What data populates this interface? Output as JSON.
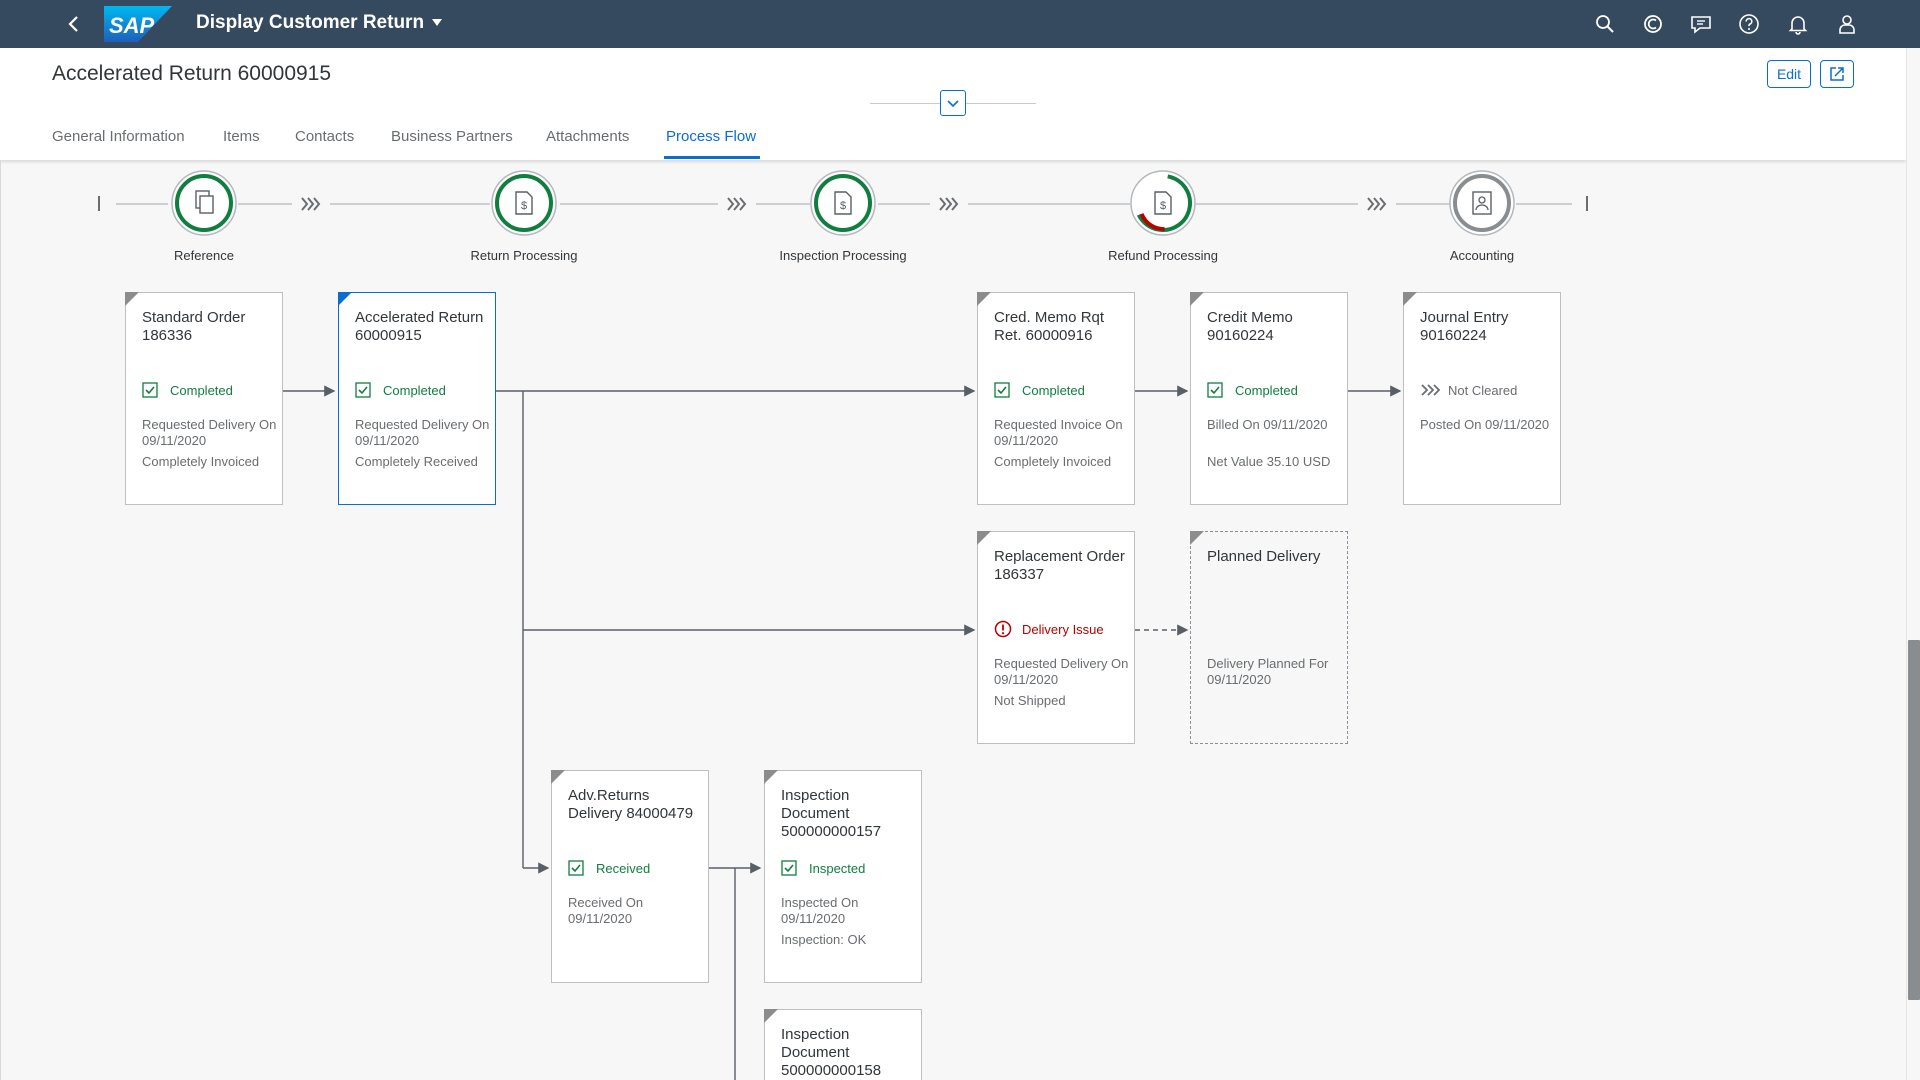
{
  "app": {
    "title": "Display Customer Return"
  },
  "header": {
    "title": "Accelerated Return 60000915",
    "edit_label": "Edit"
  },
  "tabs": [
    {
      "label": "General Information",
      "active": false
    },
    {
      "label": "Items",
      "active": false
    },
    {
      "label": "Contacts",
      "active": false
    },
    {
      "label": "Business Partners",
      "active": false
    },
    {
      "label": "Attachments",
      "active": false
    },
    {
      "label": "Process Flow",
      "active": true
    }
  ],
  "lanes": [
    {
      "label": "Reference",
      "icon": "documents-icon",
      "state": "completed"
    },
    {
      "label": "Return Processing",
      "icon": "sales-document-icon",
      "state": "completed"
    },
    {
      "label": "Inspection Processing",
      "icon": "sales-document-icon",
      "state": "completed"
    },
    {
      "label": "Refund Processing",
      "icon": "sales-document-icon",
      "state": "partial-issue"
    },
    {
      "label": "Accounting",
      "icon": "journal-icon",
      "state": "neutral"
    }
  ],
  "nodes": {
    "standard_order": {
      "title": "Standard Order 186336",
      "status": "Completed",
      "attr1": "Requested Delivery On 09/11/2020",
      "attr2": "Completely Invoiced"
    },
    "accelerated_return": {
      "title": "Accelerated Return 60000915",
      "status": "Completed",
      "attr1": "Requested Delivery On 09/11/2020",
      "attr2": "Completely Received"
    },
    "cred_memo_rqt": {
      "title": "Cred. Memo Rqt Ret. 60000916",
      "status": "Completed",
      "attr1": "Requested Invoice On 09/11/2020",
      "attr2": "Completely Invoiced"
    },
    "credit_memo": {
      "title": "Credit Memo 90160224",
      "status": "Completed",
      "attr1": "Billed On 09/11/2020",
      "attr2": "Net Value 35.10 USD"
    },
    "journal_entry": {
      "title": "Journal Entry 90160224",
      "status": "Not Cleared",
      "attr1": "Posted On 09/11/2020",
      "attr2": ""
    },
    "replacement_order": {
      "title": "Replacement Order 186337",
      "status": "Delivery Issue",
      "attr1": "Requested Delivery On 09/11/2020",
      "attr2": "Not Shipped"
    },
    "planned_delivery": {
      "title": "Planned Delivery",
      "status": "",
      "attr1": "Delivery Planned For 09/11/2020",
      "attr2": ""
    },
    "adv_returns_delivery": {
      "title": "Adv.Returns Delivery 84000479",
      "status": "Received",
      "attr1": "Received On 09/11/2020",
      "attr2": ""
    },
    "inspection_157": {
      "title": "Inspection Document 500000000157",
      "status": "Inspected",
      "attr1": "Inspected On 09/11/2020",
      "attr2": "Inspection: OK"
    },
    "inspection_158": {
      "title": "Inspection Document 500000000158",
      "status": "",
      "attr1": "",
      "attr2": ""
    }
  },
  "colors": {
    "shell": "#354a5f",
    "accent": "#0a6ed1",
    "positive": "#107e3e",
    "negative": "#bb0000",
    "neutral": "#6a6d70"
  }
}
